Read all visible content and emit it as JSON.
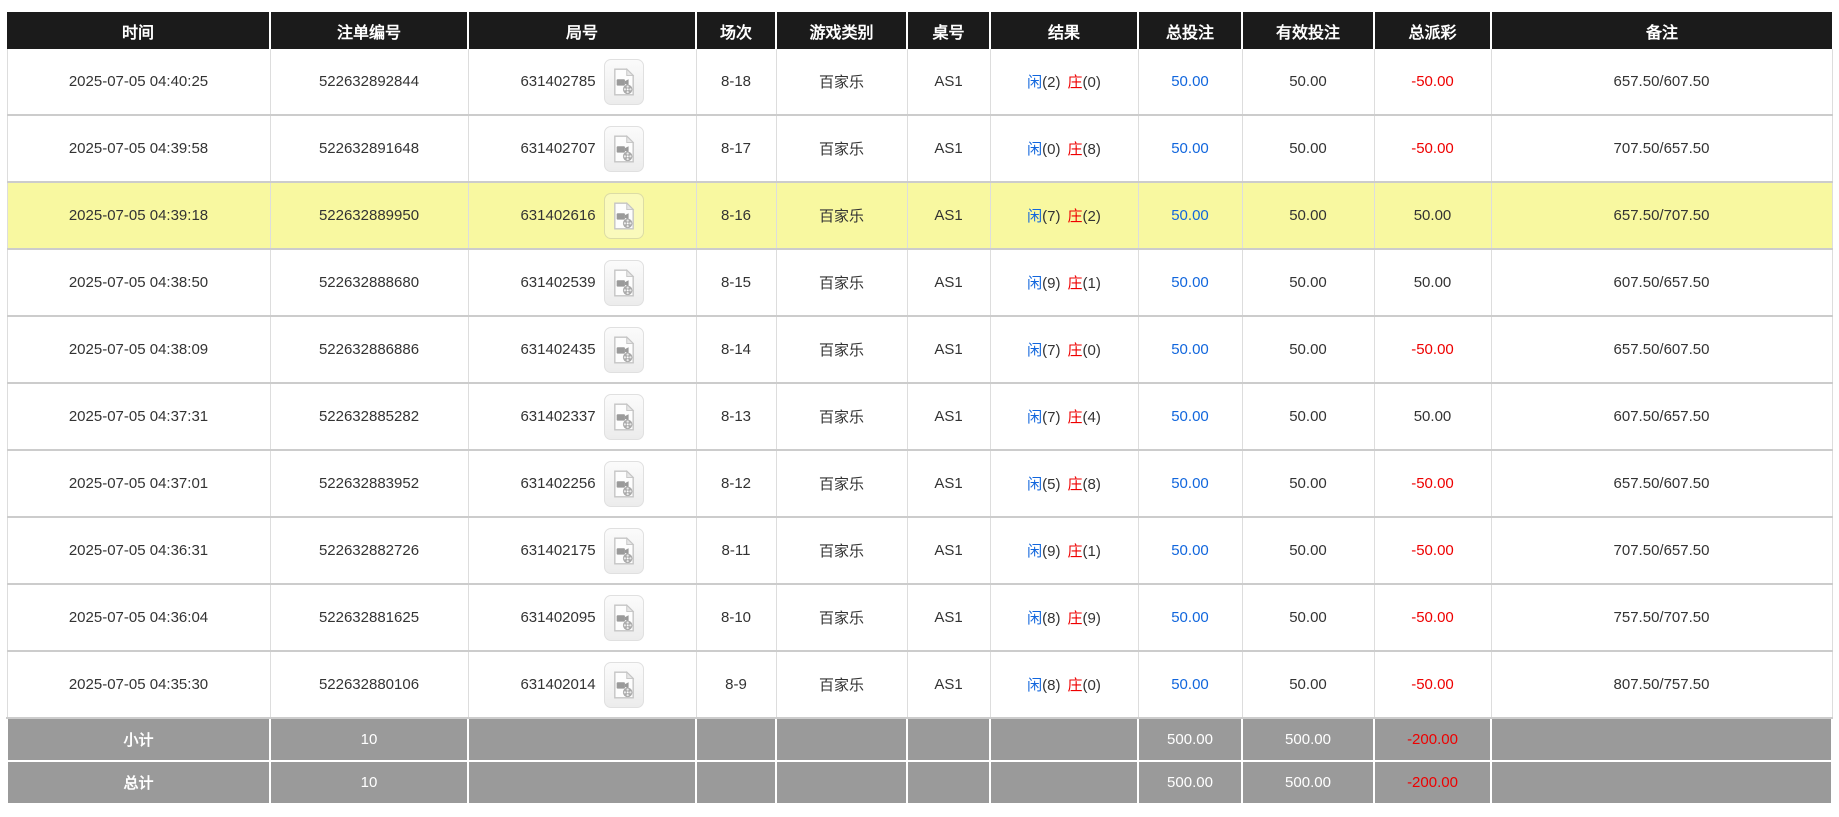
{
  "table": {
    "columns": [
      "时间",
      "注单编号",
      "局号",
      "场次",
      "游戏类别",
      "桌号",
      "结果",
      "总投注",
      "有效投注",
      "总派彩",
      "备注"
    ],
    "icons": {
      "round_cell_button": "video-file-icon"
    },
    "colors": {
      "header_bg": "#1b1b1b",
      "highlight_row": "#f8f8a0",
      "blue": "#1166dd",
      "red": "#ee0000",
      "footer_bg": "#9a9a9a"
    },
    "rows": [
      {
        "time": "2025-07-05 04:40:25",
        "bet_id": "522632892844",
        "round_no": "631402785",
        "session": "8-18",
        "game_type": "百家乐",
        "table_no": "AS1",
        "result_player_label": "闲",
        "result_player_score": "(2)",
        "result_banker_label": "庄",
        "result_banker_score": "(0)",
        "total_bet": "50.00",
        "valid_bet": "50.00",
        "payout": "-50.00",
        "remark": "657.50/607.50",
        "highlighted": false
      },
      {
        "time": "2025-07-05 04:39:58",
        "bet_id": "522632891648",
        "round_no": "631402707",
        "session": "8-17",
        "game_type": "百家乐",
        "table_no": "AS1",
        "result_player_label": "闲",
        "result_player_score": "(0)",
        "result_banker_label": "庄",
        "result_banker_score": "(8)",
        "total_bet": "50.00",
        "valid_bet": "50.00",
        "payout": "-50.00",
        "remark": "707.50/657.50",
        "highlighted": false
      },
      {
        "time": "2025-07-05 04:39:18",
        "bet_id": "522632889950",
        "round_no": "631402616",
        "session": "8-16",
        "game_type": "百家乐",
        "table_no": "AS1",
        "result_player_label": "闲",
        "result_player_score": "(7)",
        "result_banker_label": "庄",
        "result_banker_score": "(2)",
        "total_bet": "50.00",
        "valid_bet": "50.00",
        "payout": "50.00",
        "remark": "657.50/707.50",
        "highlighted": true
      },
      {
        "time": "2025-07-05 04:38:50",
        "bet_id": "522632888680",
        "round_no": "631402539",
        "session": "8-15",
        "game_type": "百家乐",
        "table_no": "AS1",
        "result_player_label": "闲",
        "result_player_score": "(9)",
        "result_banker_label": "庄",
        "result_banker_score": "(1)",
        "total_bet": "50.00",
        "valid_bet": "50.00",
        "payout": "50.00",
        "remark": "607.50/657.50",
        "highlighted": false
      },
      {
        "time": "2025-07-05 04:38:09",
        "bet_id": "522632886886",
        "round_no": "631402435",
        "session": "8-14",
        "game_type": "百家乐",
        "table_no": "AS1",
        "result_player_label": "闲",
        "result_player_score": "(7)",
        "result_banker_label": "庄",
        "result_banker_score": "(0)",
        "total_bet": "50.00",
        "valid_bet": "50.00",
        "payout": "-50.00",
        "remark": "657.50/607.50",
        "highlighted": false
      },
      {
        "time": "2025-07-05 04:37:31",
        "bet_id": "522632885282",
        "round_no": "631402337",
        "session": "8-13",
        "game_type": "百家乐",
        "table_no": "AS1",
        "result_player_label": "闲",
        "result_player_score": "(7)",
        "result_banker_label": "庄",
        "result_banker_score": "(4)",
        "total_bet": "50.00",
        "valid_bet": "50.00",
        "payout": "50.00",
        "remark": "607.50/657.50",
        "highlighted": false
      },
      {
        "time": "2025-07-05 04:37:01",
        "bet_id": "522632883952",
        "round_no": "631402256",
        "session": "8-12",
        "game_type": "百家乐",
        "table_no": "AS1",
        "result_player_label": "闲",
        "result_player_score": "(5)",
        "result_banker_label": "庄",
        "result_banker_score": "(8)",
        "total_bet": "50.00",
        "valid_bet": "50.00",
        "payout": "-50.00",
        "remark": "657.50/607.50",
        "highlighted": false
      },
      {
        "time": "2025-07-05 04:36:31",
        "bet_id": "522632882726",
        "round_no": "631402175",
        "session": "8-11",
        "game_type": "百家乐",
        "table_no": "AS1",
        "result_player_label": "闲",
        "result_player_score": "(9)",
        "result_banker_label": "庄",
        "result_banker_score": "(1)",
        "total_bet": "50.00",
        "valid_bet": "50.00",
        "payout": "-50.00",
        "remark": "707.50/657.50",
        "highlighted": false
      },
      {
        "time": "2025-07-05 04:36:04",
        "bet_id": "522632881625",
        "round_no": "631402095",
        "session": "8-10",
        "game_type": "百家乐",
        "table_no": "AS1",
        "result_player_label": "闲",
        "result_player_score": "(8)",
        "result_banker_label": "庄",
        "result_banker_score": "(9)",
        "total_bet": "50.00",
        "valid_bet": "50.00",
        "payout": "-50.00",
        "remark": "757.50/707.50",
        "highlighted": false
      },
      {
        "time": "2025-07-05 04:35:30",
        "bet_id": "522632880106",
        "round_no": "631402014",
        "session": "8-9",
        "game_type": "百家乐",
        "table_no": "AS1",
        "result_player_label": "闲",
        "result_player_score": "(8)",
        "result_banker_label": "庄",
        "result_banker_score": "(0)",
        "total_bet": "50.00",
        "valid_bet": "50.00",
        "payout": "-50.00",
        "remark": "807.50/757.50",
        "highlighted": false
      }
    ],
    "footer": [
      {
        "label": "小计",
        "count": "10",
        "total_bet": "500.00",
        "valid_bet": "500.00",
        "payout": "-200.00"
      },
      {
        "label": "总计",
        "count": "10",
        "total_bet": "500.00",
        "valid_bet": "500.00",
        "payout": "-200.00"
      }
    ]
  }
}
